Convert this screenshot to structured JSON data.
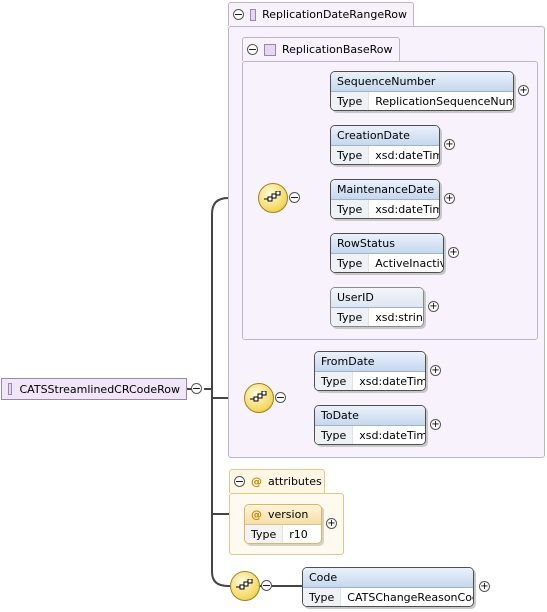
{
  "root": {
    "name": "CATSStreamlinedCRCodeRow"
  },
  "outer_group": {
    "name": "ReplicationDateRangeRow"
  },
  "inner_group": {
    "name": "ReplicationBaseRow"
  },
  "type_label": "Type",
  "base_elements": [
    {
      "name": "SequenceNumber",
      "type": "ReplicationSequenceNumber"
    },
    {
      "name": "CreationDate",
      "type": "xsd:dateTime"
    },
    {
      "name": "MaintenanceDate",
      "type": "xsd:dateTime"
    },
    {
      "name": "RowStatus",
      "type": "ActiveInactive"
    },
    {
      "name": "UserID",
      "type": "xsd:string"
    }
  ],
  "range_elements": [
    {
      "name": "FromDate",
      "type": "xsd:dateTime"
    },
    {
      "name": "ToDate",
      "type": "xsd:dateTime"
    }
  ],
  "attributes": {
    "label": "attributes",
    "version": {
      "name": "version",
      "type": "r10"
    }
  },
  "code_element": {
    "name": "Code",
    "type": "CATSChangeReasonCode"
  },
  "symbols": {
    "minus": "−",
    "plus": "+",
    "at": "@"
  },
  "colors": {
    "group_border": "#bfb3cc",
    "group_fill": "#f7f2fb",
    "element_header": "#c6d8ee",
    "attribute_fill": "#fff6e4",
    "sequence_fill": "#f3d65a"
  }
}
